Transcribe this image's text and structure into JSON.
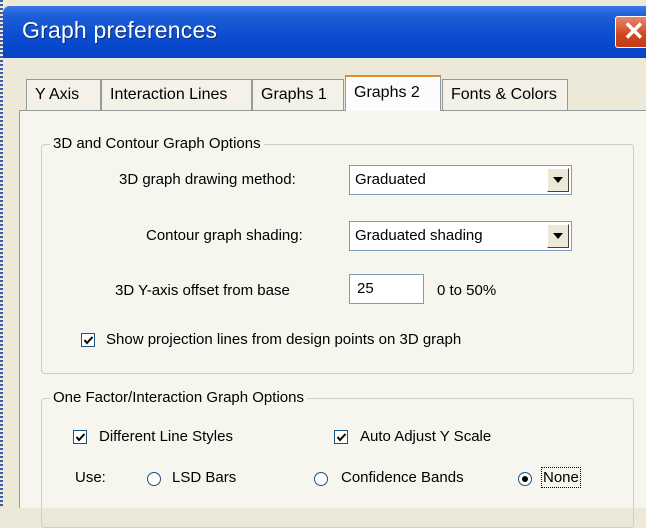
{
  "window": {
    "title": "Graph preferences",
    "close_label": "✕"
  },
  "tabs": [
    {
      "label": "Y Axis",
      "active": false
    },
    {
      "label": "Interaction Lines",
      "active": false
    },
    {
      "label": "Graphs 1",
      "active": false
    },
    {
      "label": "Graphs 2",
      "active": true
    },
    {
      "label": "Fonts & Colors",
      "active": false
    }
  ],
  "group3d": {
    "legend": "3D and Contour Graph Options",
    "drawing_method_label": "3D graph drawing method:",
    "drawing_method_value": "Graduated",
    "contour_shading_label": "Contour graph shading:",
    "contour_shading_value": "Graduated shading",
    "y_offset_label": "3D Y-axis offset from base",
    "y_offset_value": "25",
    "y_offset_range": "0 to 50%",
    "projection_label": "Show projection lines from design points on 3D graph",
    "projection_checked": true
  },
  "groupOneFactor": {
    "legend": "One Factor/Interaction Graph Options",
    "line_styles_label": "Different Line Styles",
    "line_styles_checked": true,
    "auto_adjust_label": "Auto Adjust Y Scale",
    "auto_adjust_checked": true,
    "use_label": "Use:",
    "options": [
      {
        "label": "LSD Bars",
        "selected": false
      },
      {
        "label": "Confidence Bands",
        "selected": false
      },
      {
        "label": "None",
        "selected": true
      }
    ]
  },
  "colors": {
    "titlebar": "#0a4cd0",
    "close": "#d0451f",
    "tab_accent": "#e68b2c"
  }
}
